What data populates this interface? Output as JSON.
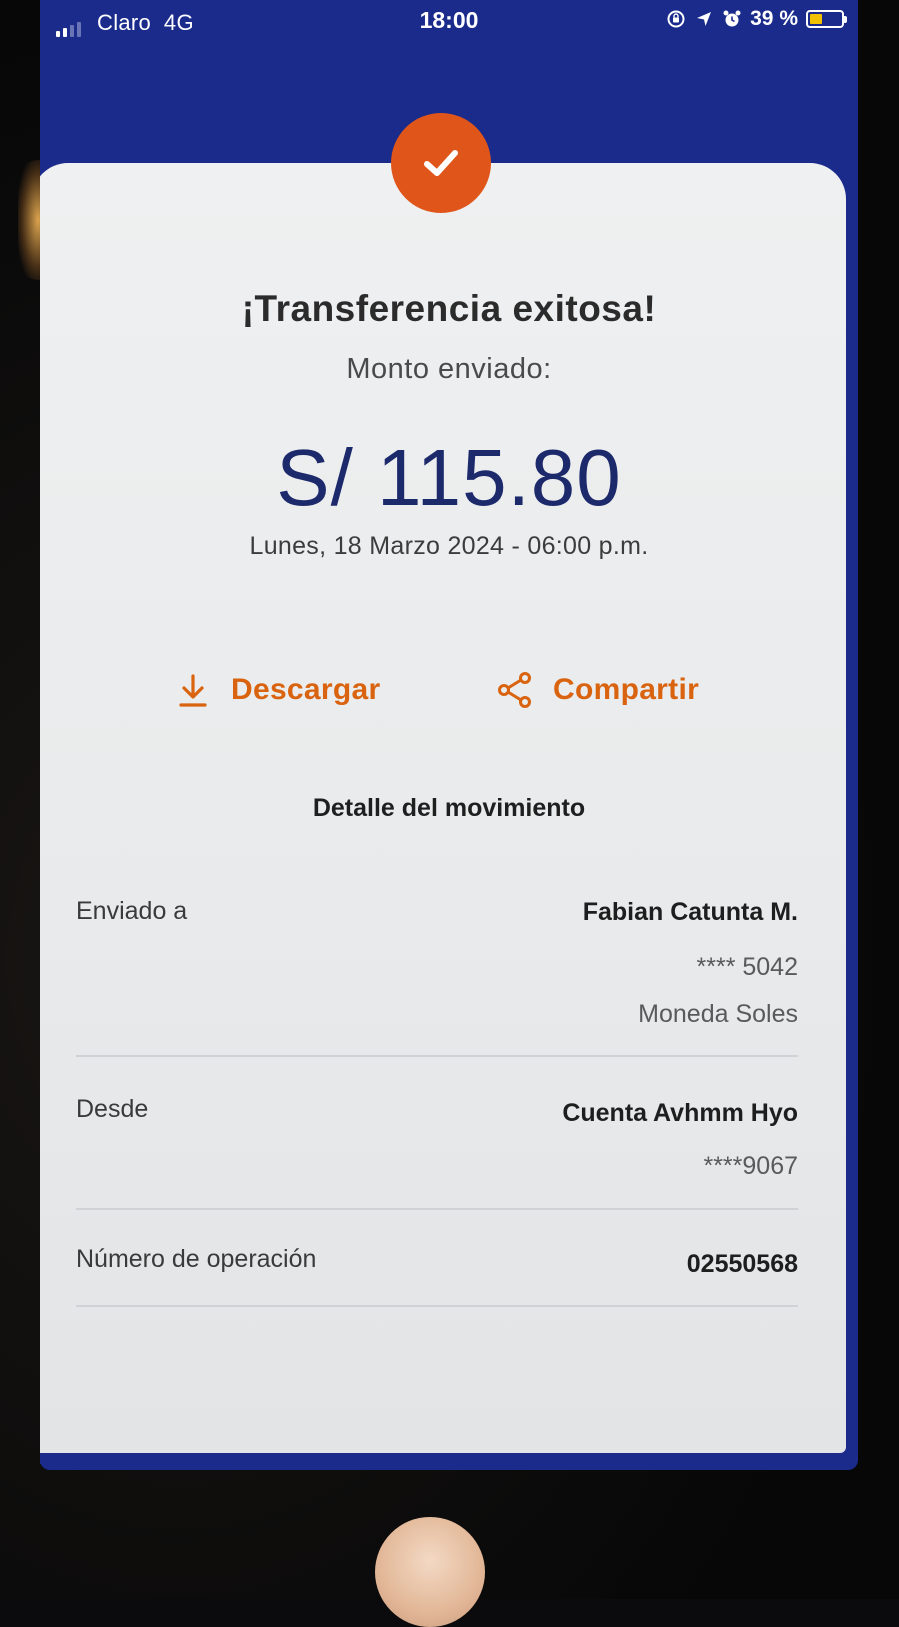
{
  "status_bar": {
    "carrier": "Claro",
    "network": "4G",
    "time": "18:00",
    "battery_percent": "39 %",
    "battery_level": 0.39,
    "battery_color": "#f2c100",
    "icons": [
      "signal-icon",
      "orientation-lock-icon",
      "location-icon",
      "alarm-icon",
      "battery-icon"
    ]
  },
  "colors": {
    "header_blue": "#1a2b8c",
    "accent_orange": "#e0561a",
    "amount_navy": "#1c2a6b"
  },
  "receipt": {
    "status_icon": "check-icon",
    "title": "¡Transferencia exitosa!",
    "amount_label": "Monto enviado:",
    "amount": "S/ 115.80",
    "datetime": "Lunes, 18 Marzo 2024 - 06:00 p.m."
  },
  "actions": {
    "download_label": "Descargar",
    "download_icon": "download-icon",
    "share_label": "Compartir",
    "share_icon": "share-icon"
  },
  "details": {
    "header": "Detalle del movimiento",
    "sent_to": {
      "label": "Enviado a",
      "name": "Fabian Catunta M.",
      "account": "**** 5042",
      "currency": "Moneda Soles"
    },
    "from": {
      "label": "Desde",
      "account_name": "Cuenta Avhmm Hyo",
      "account_number": "****9067"
    },
    "operation": {
      "label": "Número de operación",
      "value": "02550568"
    }
  }
}
